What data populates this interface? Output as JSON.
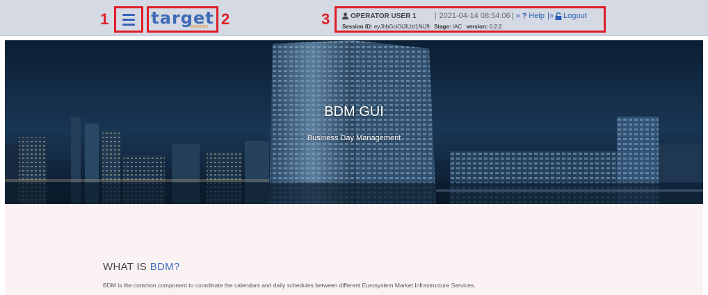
{
  "header": {
    "callouts": [
      "1",
      "2",
      "3"
    ],
    "menu_icon": "hamburger-menu-icon",
    "logo": {
      "text": "target",
      "subtext": "services"
    },
    "user": {
      "icon": "user-icon",
      "name": "OPERATOR USER 1"
    },
    "separator_left": "|",
    "datetime": "2021-04-14 08:54:06",
    "separator_mid": "|",
    "help_prefix": "»",
    "help_icon": "question-mark-icon",
    "help_label": "Help",
    "logout_prefix": "|»",
    "logout_icon": "unlock-icon",
    "logout_label": "Logout",
    "session_label": "Session ID:",
    "session_value": "eyJhbGciOiJIUzI1NiJ9",
    "stage_label": "Stage:",
    "stage_value": "IAC",
    "version_label": "version:",
    "version_value": "0.2.2"
  },
  "hero": {
    "title": "BDM GUI",
    "subtitle": "Business Day Management"
  },
  "main": {
    "heading_prefix": "WHAT IS ",
    "heading_accent": "BDM?",
    "description": "BDM is the common component to coordinate the calendars and daily schedules between different Eurosystem Market Infrastructure Services."
  },
  "colors": {
    "accent": "#3a6fc0",
    "callout_red": "#e0202a",
    "topbar": "#d4d9e3",
    "logo_orange": "#e08a1e",
    "content_bg": "#fbf3f3"
  }
}
